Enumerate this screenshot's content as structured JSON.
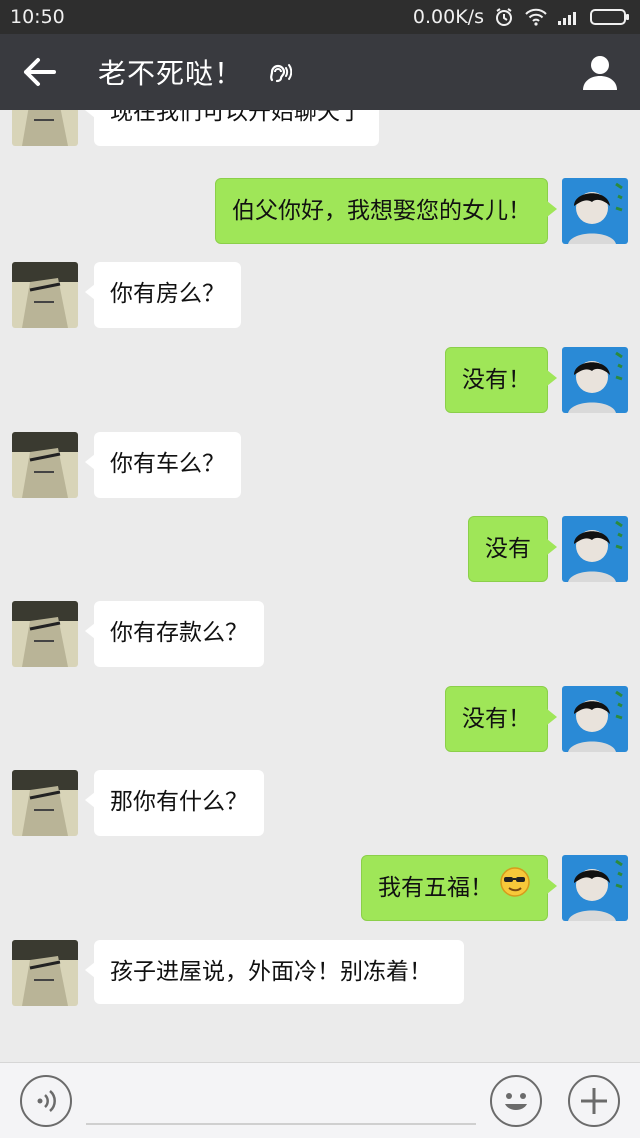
{
  "status_bar": {
    "time": "10:50",
    "network_speed": "0.00K/s",
    "icons": [
      "alarm-icon",
      "wifi-icon",
      "signal-icon",
      "battery-icon"
    ]
  },
  "header": {
    "title": "老不死哒！",
    "icons": [
      "back-arrow-icon",
      "ear-icon",
      "profile-icon"
    ]
  },
  "messages": [
    {
      "side": "in",
      "text": "现在我们可以开始聊天了"
    },
    {
      "side": "out",
      "text": "伯父你好，我想娶您的女儿！"
    },
    {
      "side": "in",
      "text": "你有房么？"
    },
    {
      "side": "out",
      "text": "没有！"
    },
    {
      "side": "in",
      "text": "你有车么？"
    },
    {
      "side": "out",
      "text": "没有"
    },
    {
      "side": "in",
      "text": "你有存款么？"
    },
    {
      "side": "out",
      "text": "没有！"
    },
    {
      "side": "in",
      "text": "那你有什么？"
    },
    {
      "side": "out",
      "text": "我有五福！",
      "emoji": "cool-sunglasses-emoji"
    },
    {
      "side": "in",
      "text": "孩子进屋说，外面冷！别冻着！"
    }
  ],
  "input_bar": {
    "icons": [
      "voice-icon",
      "emoji-icon",
      "plus-icon"
    ]
  },
  "colors": {
    "status_bar": "#2e2e2e",
    "title_bar": "#393a3f",
    "chat_background": "#ebebeb",
    "outgoing_bubble": "#9fe658",
    "incoming_bubble": "#ffffff"
  }
}
